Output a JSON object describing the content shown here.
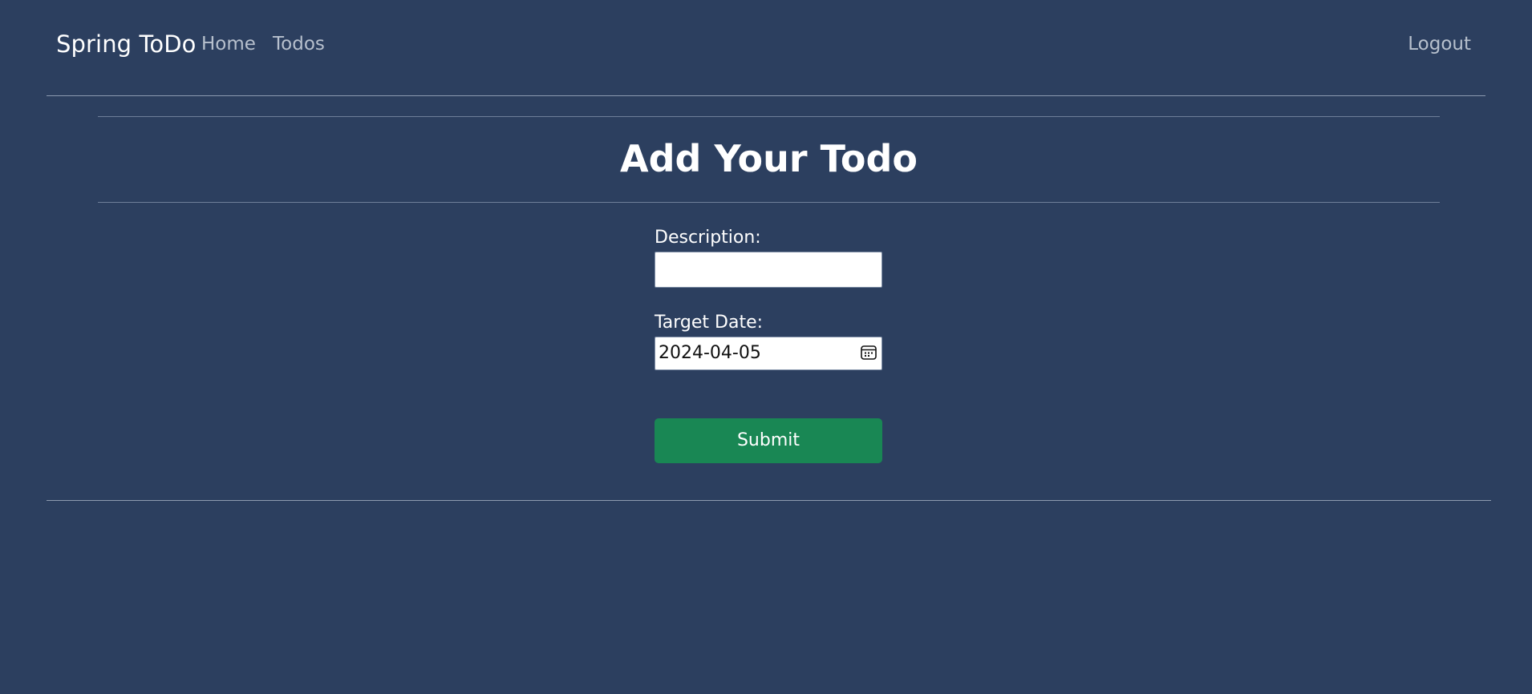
{
  "navbar": {
    "brand": "Spring ToDo",
    "links": [
      {
        "label": "Home"
      },
      {
        "label": "Todos"
      }
    ],
    "logout": "Logout"
  },
  "page": {
    "title": "Add Your Todo"
  },
  "form": {
    "description": {
      "label": "Description:",
      "value": "",
      "placeholder": ""
    },
    "target_date": {
      "label": "Target Date:",
      "value": "2024-04-05"
    },
    "submit_label": "Submit"
  },
  "colors": {
    "background": "#2c3f5f",
    "submit": "#198754",
    "nav_link": "#b7c0cd"
  },
  "icons": {
    "date_picker": "calendar-icon"
  }
}
